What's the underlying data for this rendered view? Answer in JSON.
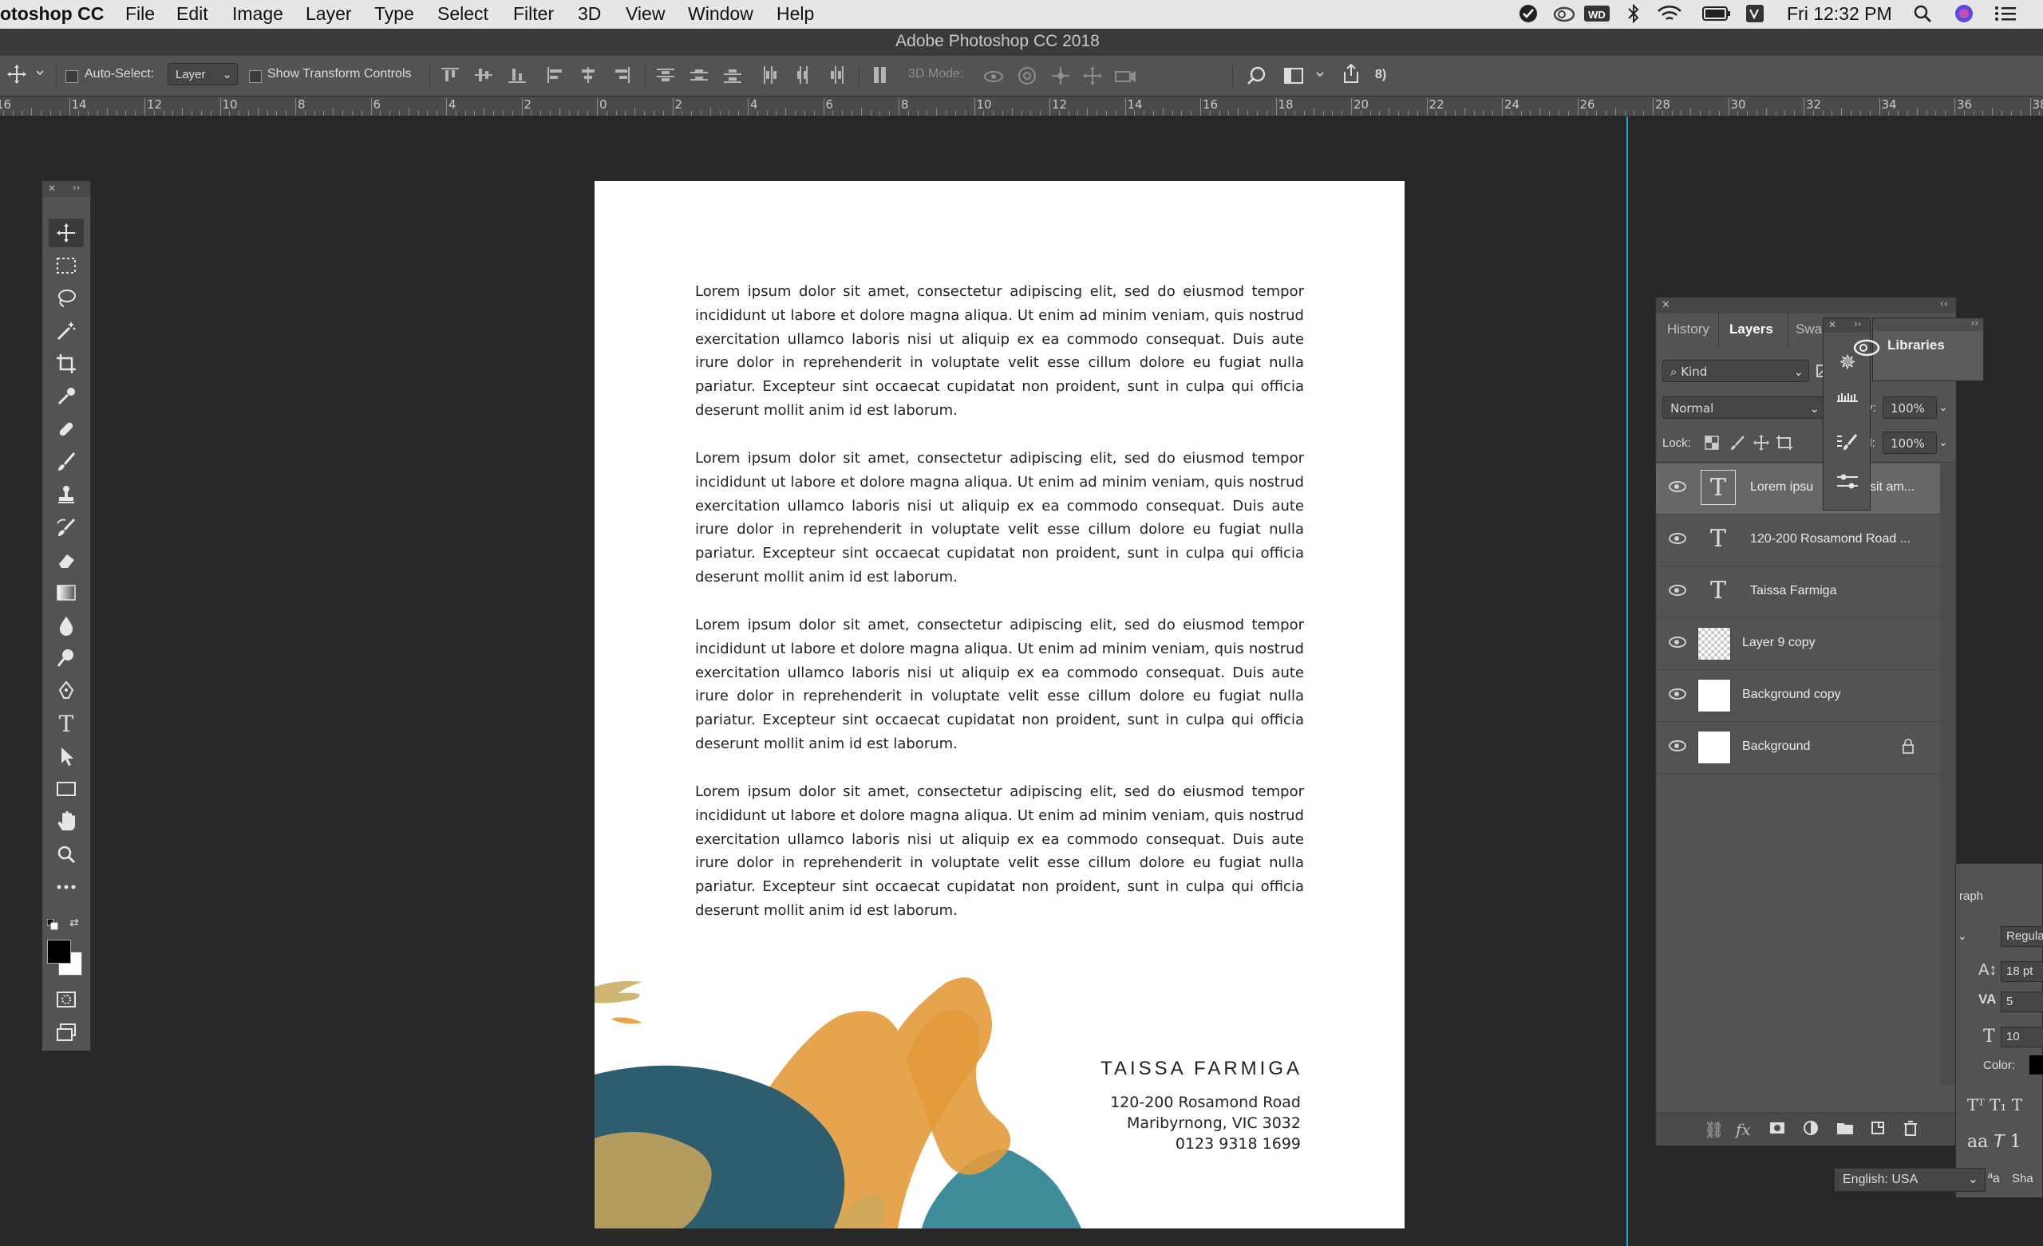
{
  "menubar": {
    "app": "otoshop CC",
    "items": [
      "File",
      "Edit",
      "Image",
      "Layer",
      "Type",
      "Select",
      "Filter",
      "3D",
      "View",
      "Window",
      "Help"
    ],
    "clock": "Fri 12:32 PM",
    "status_icons": [
      "checkmark-icon",
      "creative-cloud-icon",
      "wd-drive-icon",
      "bluetooth-icon",
      "wifi-icon",
      "battery-icon",
      "input-source-icon",
      "clock",
      "spotlight-icon",
      "siri-icon",
      "notification-center-icon"
    ],
    "wd_label": "WD"
  },
  "window": {
    "title": "Adobe Photoshop CC 2018"
  },
  "options_bar": {
    "auto_select_label": "Auto-Select:",
    "auto_select_value": "Layer",
    "show_transform_label": "Show Transform Controls",
    "mode_3d_label": "3D Mode:",
    "partial_text": "8)"
  },
  "ruler": {
    "labels": [
      "16",
      "14",
      "12",
      "10",
      "8",
      "6",
      "4",
      "2",
      "0",
      "2",
      "4",
      "6",
      "8",
      "10",
      "12",
      "14",
      "16",
      "18",
      "20",
      "22",
      "24",
      "26",
      "28",
      "30",
      "32",
      "34",
      "36",
      "38"
    ]
  },
  "toolbar": {
    "tools": [
      "move-tool",
      "marquee-tool",
      "lasso-tool",
      "magic-wand-tool",
      "crop-tool",
      "eyedropper-tool",
      "healing-brush-tool",
      "brush-tool",
      "clone-stamp-tool",
      "history-brush-tool",
      "eraser-tool",
      "gradient-tool",
      "blur-tool",
      "dodge-tool",
      "pen-tool",
      "type-tool",
      "path-selection-tool",
      "rectangle-tool",
      "hand-tool",
      "zoom-tool",
      "more-tools"
    ],
    "foreground_color": "#000000",
    "background_color": "#ffffff"
  },
  "document": {
    "paragraphs": [
      "Lorem ipsum dolor sit amet, consectetur adipiscing elit, sed do eiusmod tempor incididunt ut labore et dolore magna aliqua. Ut enim ad minim veniam, quis nostrud exercitation ullamco laboris nisi ut aliquip ex ea commodo consequat. Duis aute irure dolor in reprehenderit in voluptate velit esse cillum dolore eu fugiat nulla pariatur. Excepteur sint occaecat cupidatat non proident, sunt in culpa qui officia deserunt mollit anim id est laborum.",
      "Lorem ipsum dolor sit amet, consectetur adipiscing elit, sed do eiusmod tempor incididunt ut labore et dolore magna aliqua. Ut enim ad minim veniam, quis nostrud exercitation ullamco laboris nisi ut aliquip ex ea commodo consequat. Duis aute irure dolor in reprehenderit in voluptate velit esse cillum dolore eu fugiat nulla pariatur. Excepteur sint occaecat cupidatat non proident, sunt in culpa qui officia deserunt mollit anim id est laborum.",
      "Lorem ipsum dolor sit amet, consectetur adipiscing elit, sed do eiusmod tempor incididunt ut labore et dolore magna aliqua. Ut enim ad minim veniam, quis nostrud exercitation ullamco laboris nisi ut aliquip ex ea commodo consequat. Duis aute irure dolor in reprehenderit in voluptate velit esse cillum dolore eu fugiat nulla pariatur. Excepteur sint occaecat cupidatat non proident, sunt in culpa qui officia deserunt mollit anim id est laborum.",
      "Lorem ipsum dolor sit amet, consectetur adipiscing elit, sed do eiusmod tempor incididunt ut labore et dolore magna aliqua. Ut enim ad minim veniam, quis nostrud exercitation ullamco laboris nisi ut aliquip ex ea commodo consequat. Duis aute irure dolor in reprehenderit in voluptate velit esse cillum dolore eu fugiat nulla pariatur. Excepteur sint occaecat cupidatat non proident, sunt in culpa qui officia deserunt mollit anim id est laborum."
    ],
    "signature_name": "TAISSA FARMIGA",
    "address_line1": "120-200 Rosamond Road",
    "address_line2": "Maribyrnong, VIC 3032",
    "phone": "0123 9318 1699",
    "paint_colors": {
      "orange": "#e39a3b",
      "teal": "#3f8d9b",
      "navy": "#2f5d70",
      "gold": "#c9a85c"
    }
  },
  "layers_panel": {
    "tabs": [
      "History",
      "Layers",
      "Swa"
    ],
    "filter_label": "Kind",
    "blend_mode": "Normal",
    "opacity_label": "y:",
    "opacity_value": "100%",
    "fill_label": "ll:",
    "fill_value": "100%",
    "lock_label": "Lock:",
    "layers": [
      {
        "name": "Lorem ipsu",
        "name_tail": "sit am...",
        "kind": "text"
      },
      {
        "name": "120-200 Rosamond Road ...",
        "kind": "text"
      },
      {
        "name": "Taissa Farmiga",
        "kind": "text"
      },
      {
        "name": "Layer 9 copy",
        "kind": "pixel"
      },
      {
        "name": "Background copy",
        "kind": "pixel"
      },
      {
        "name": "Background",
        "kind": "locked"
      }
    ]
  },
  "libraries_panel": {
    "label": "Libraries"
  },
  "character_panel": {
    "title_partial": "raph",
    "font_style": "Regula",
    "leading": "18 pt",
    "tracking": "5",
    "scale_partial": "10",
    "color_label": "Color:",
    "aa_partial": "Sha",
    "language": "English: USA"
  }
}
